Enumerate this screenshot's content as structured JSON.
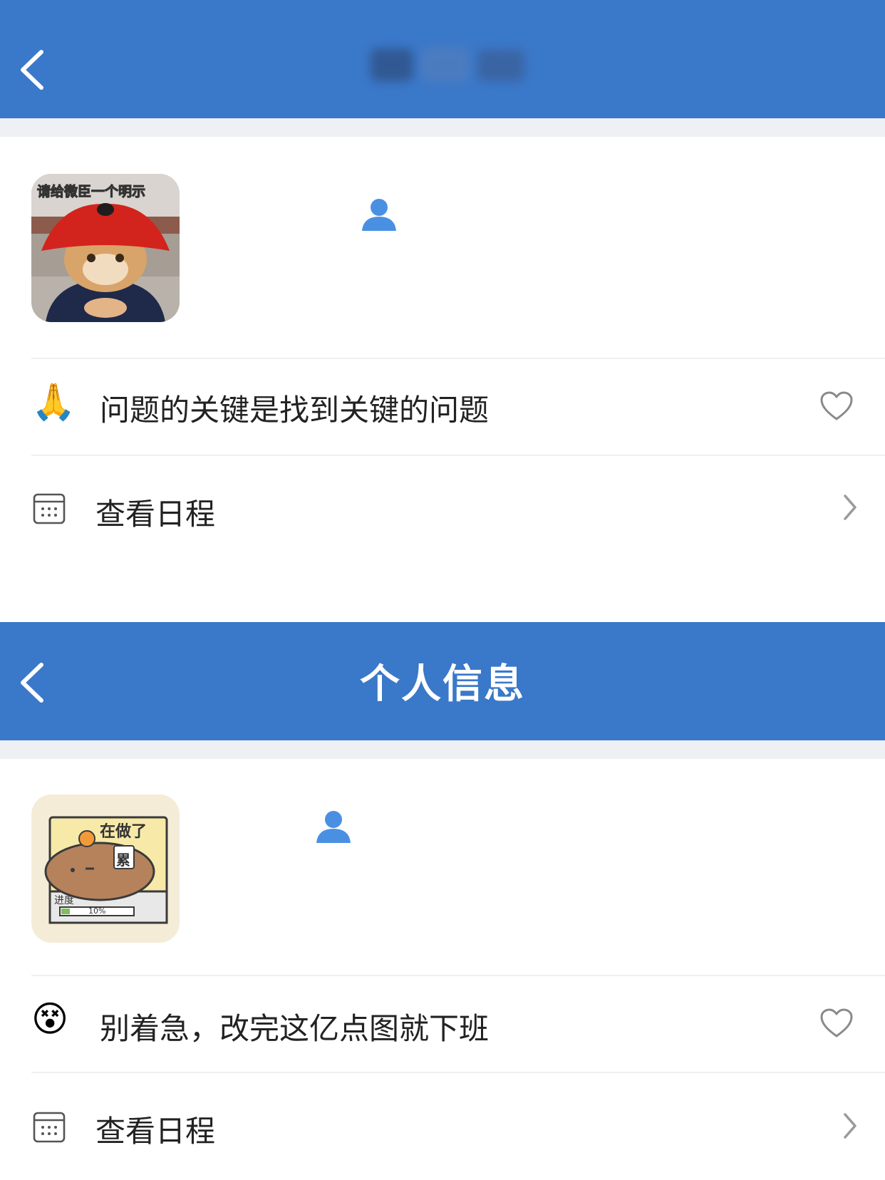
{
  "colors": {
    "header_bg": "#3a78c9",
    "accent_icon": "#4a90e2"
  },
  "screen1": {
    "header": {
      "title": "",
      "back_icon": "chevron-left-icon"
    },
    "avatar": {
      "image": "cat-official-hat-avatar",
      "caption": "请给微臣一个明示"
    },
    "user_icon": "person-icon",
    "signature": {
      "emoji": "🙏",
      "text": "问题的关键是找到关键的问题",
      "like_icon": "heart-outline-icon"
    },
    "schedule": {
      "icon": "calendar-icon",
      "label": "查看日程",
      "chevron_icon": "chevron-right-icon"
    }
  },
  "screen2": {
    "header": {
      "title": "个人信息",
      "back_icon": "chevron-left-icon"
    },
    "avatar": {
      "image": "capybara-progress-avatar",
      "caption": "在做了",
      "badge": "累",
      "progress_label": "进度",
      "progress_value": "10%"
    },
    "user_icon": "person-icon",
    "signature": {
      "emoji": "😵",
      "text": "别着急，改完这亿点图就下班",
      "like_icon": "heart-outline-icon"
    },
    "schedule": {
      "icon": "calendar-icon",
      "label": "查看日程",
      "chevron_icon": "chevron-right-icon"
    }
  }
}
